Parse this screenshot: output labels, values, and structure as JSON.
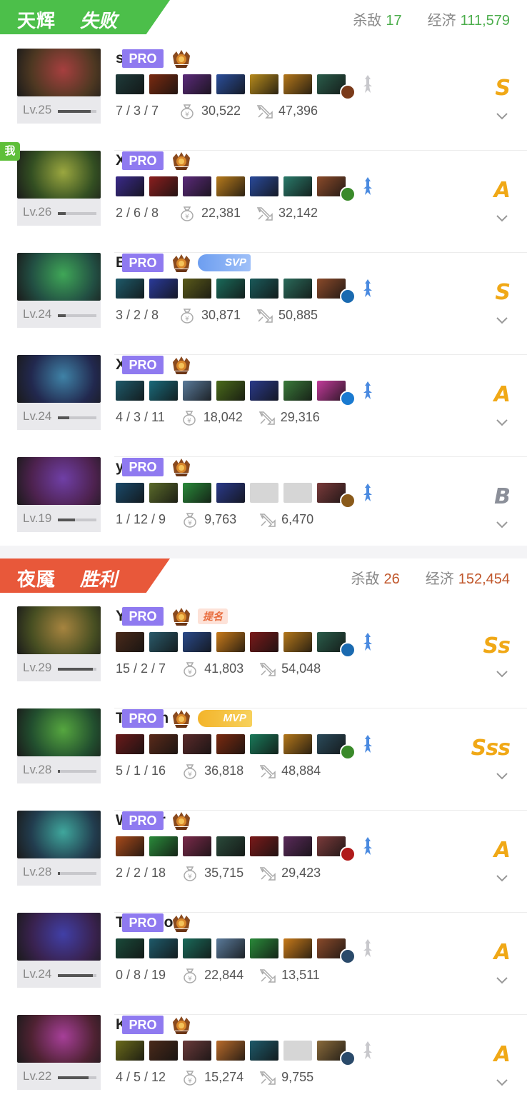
{
  "teams": [
    {
      "name": "天辉",
      "result": "失败",
      "kills_label": "杀敌",
      "kills": "17",
      "gold_label": "经济",
      "gold": "111,579",
      "banner_color": "#4cbf4a",
      "stat_color": "#4cae4c",
      "players": [
        {
          "name": "shiro",
          "pro": "PRO",
          "level": "Lv.25",
          "level_pct": 0.85,
          "kda": "7 / 3 / 7",
          "gold": "30,522",
          "damage": "47,396",
          "grade": "S",
          "me": false,
          "badge": "",
          "aghs_active": false,
          "items": [
            "#1e3b3a",
            "#7a2a10",
            "#5b2a7a",
            "#2b4e9a",
            "#b78a1c",
            "#b4771a",
            "#2a5c4a"
          ],
          "neutral": "#7a3a1a"
        },
        {
          "name": "Xm",
          "pro": "PRO",
          "level": "Lv.26",
          "level_pct": 0.2,
          "kda": "2 / 6 / 8",
          "gold": "22,381",
          "damage": "32,142",
          "grade": "A",
          "me": true,
          "me_label": "我",
          "badge": "",
          "aghs_active": true,
          "items": [
            "#3a2a8a",
            "#8a1e1e",
            "#5b2a7a",
            "#b77a1c",
            "#2a4a9a",
            "#2a7a6a",
            "#8a4a2a"
          ],
          "neutral": "#3a8a2a"
        },
        {
          "name": "Bach",
          "pro": "PRO",
          "level": "Lv.24",
          "level_pct": 0.2,
          "kda": "3 / 2 / 8",
          "gold": "30,871",
          "damage": "50,885",
          "grade": "S",
          "me": false,
          "badge": "SVP",
          "aghs_active": true,
          "items": [
            "#1e5a6a",
            "#2a3a9a",
            "#5a5a1a",
            "#1a6a5a",
            "#1a5a5a",
            "#2a6a5a",
            "#8a4a2a"
          ],
          "neutral": "#1a6ab0"
        },
        {
          "name": "XinQ",
          "pro": "PRO",
          "level": "Lv.24",
          "level_pct": 0.3,
          "kda": "4 / 3 / 11",
          "gold": "18,042",
          "damage": "29,316",
          "grade": "A",
          "me": false,
          "badge": "",
          "aghs_active": true,
          "items": [
            "#1e5a6a",
            "#1a6a7a",
            "#5a7a9a",
            "#4a6a1a",
            "#2a3a8a",
            "#3a7a3a",
            "#c23a9a"
          ],
          "neutral": "#1a7ad0"
        },
        {
          "name": "y`",
          "pro": "PRO",
          "level": "Lv.19",
          "level_pct": 0.45,
          "kda": "1 / 12 / 9",
          "gold": "9,763",
          "damage": "6,470",
          "grade": "B",
          "me": false,
          "badge": "",
          "aghs_active": true,
          "items": [
            "#1a4a6a",
            "#5a6a2a",
            "#2a8a3a",
            "#2a3a8a",
            "",
            "",
            "#7a3a3a"
          ],
          "neutral": "#8a5a1a"
        }
      ]
    },
    {
      "name": "夜魇",
      "result": "胜利",
      "kills_label": "杀敌",
      "kills": "26",
      "gold_label": "经济",
      "gold": "152,454",
      "banner_color": "#e8583a",
      "stat_color": "#c0562a",
      "players": [
        {
          "name": "Yuma",
          "pro": "PRO",
          "level": "Lv.29",
          "level_pct": 0.9,
          "kda": "15 / 2 / 7",
          "gold": "41,803",
          "damage": "54,048",
          "grade": "Ss",
          "me": false,
          "badge": "提名",
          "aghs_active": true,
          "items": [
            "#4a2a1a",
            "#2a5a6a",
            "#2a4a8a",
            "#c87a1a",
            "#7a1a1a",
            "#b4771a",
            "#2a5c4a"
          ],
          "neutral": "#1a6ab0"
        },
        {
          "name": "Topson",
          "pro": "PRO",
          "level": "Lv.28",
          "level_pct": 0.05,
          "kda": "5 / 1 / 16",
          "gold": "36,818",
          "damage": "48,884",
          "grade": "Sss",
          "me": false,
          "badge": "MVP",
          "aghs_active": true,
          "items": [
            "#6a1a1a",
            "#5a2a1a",
            "#5a2a2a",
            "#7a2a10",
            "#1a7a5a",
            "#b4771a",
            "#2a4a5a"
          ],
          "neutral": "#3a8a2a"
        },
        {
          "name": "Wisper",
          "pro": "PRO",
          "level": "Lv.28",
          "level_pct": 0.05,
          "kda": "2 / 2 / 18",
          "gold": "35,715",
          "damage": "29,423",
          "grade": "A",
          "me": false,
          "badge": "",
          "aghs_active": true,
          "items": [
            "#a84a1a",
            "#2a8a3a",
            "#7a2a4a",
            "#2a4a3a",
            "#7a1a1a",
            "#5a2a5a",
            "#7a3a3a"
          ],
          "neutral": "#b01a1a"
        },
        {
          "name": "Thiolicor",
          "pro": "PRO",
          "level": "Lv.24",
          "level_pct": 0.9,
          "kda": "0 / 8 / 19",
          "gold": "22,844",
          "damage": "13,511",
          "grade": "A",
          "me": false,
          "badge": "",
          "aghs_active": false,
          "items": [
            "#1a4a3a",
            "#1e5a6a",
            "#1a6a5a",
            "#5a7a9a",
            "#2a8a3a",
            "#c87a1a",
            "#8a4a2a"
          ],
          "neutral": "#2a4a6a"
        },
        {
          "name": "KJ",
          "pro": "PRO",
          "level": "Lv.22",
          "level_pct": 0.8,
          "kda": "4 / 5 / 12",
          "gold": "15,274",
          "damage": "9,755",
          "grade": "A",
          "me": false,
          "badge": "",
          "aghs_active": false,
          "items": [
            "#6a6a1a",
            "#4a2a1a",
            "#6a3a3a",
            "#b86a2a",
            "#1e5a6a",
            "",
            "#8a6a3a"
          ],
          "neutral": "#2a4a6a"
        }
      ]
    }
  ]
}
